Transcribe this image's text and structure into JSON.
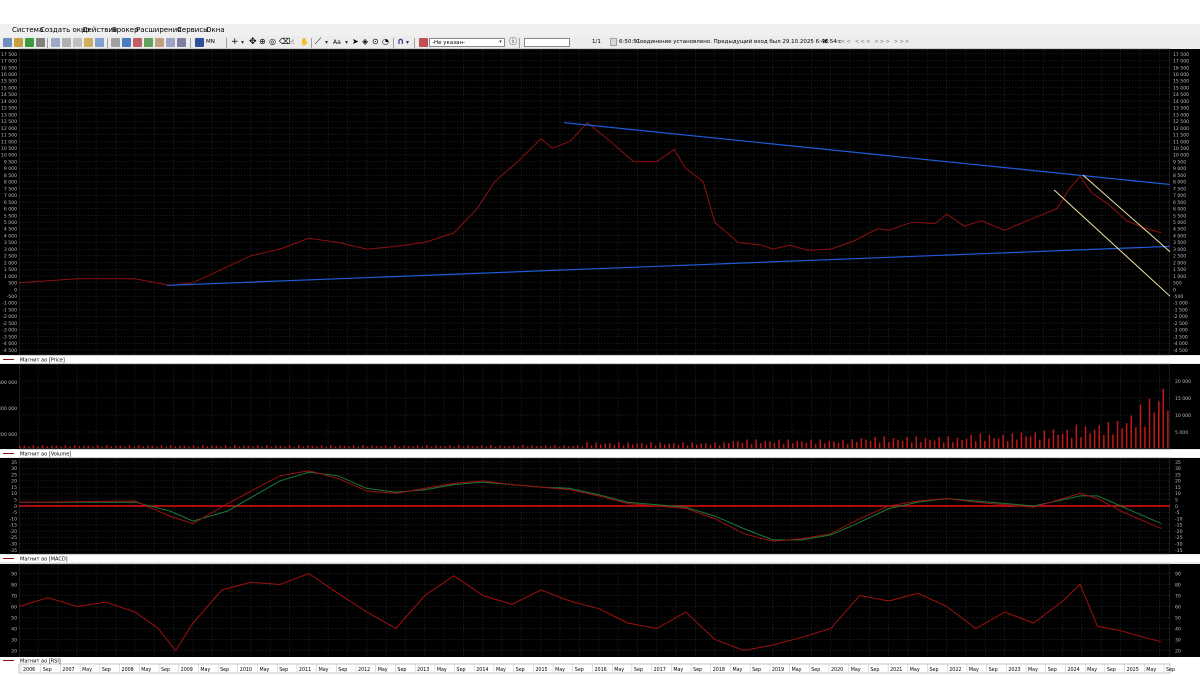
{
  "menu": [
    "Система",
    "Создать окно",
    "Действия",
    "Брокер",
    "Расширения",
    "Сервисы",
    "Окна"
  ],
  "toolbar": {
    "timeframe": "MN",
    "security_combo": "-Не указан-",
    "page_counter": "1/1",
    "status_time": "6:50:51",
    "status_message": "Соединение установлено. Предыдущий вход был 29.10.2025 6:48:54 с",
    "close_symbol": "✕",
    "nav_arrows": "<<< <<< >>> >>>"
  },
  "colors": {
    "background": "#000000",
    "grid": "#3c3c3c",
    "price_line": "#8b1010",
    "trendline_blue": "#1f5bd6",
    "channel_yellow": "#f2e6a0",
    "volume_bar": "#c01818",
    "macd_line": "#9a1010",
    "macd_signal": "#1a7a3a",
    "zero_line": "#e01010",
    "rsi_line": "#a01010"
  },
  "panels": {
    "price": {
      "legend": "Магнит ао [Price]",
      "ticks": [
        "17 500",
        "17 000",
        "16 500",
        "16 000",
        "15 500",
        "15 000",
        "14 500",
        "14 000",
        "13 500",
        "13 000",
        "12 500",
        "12 000",
        "11 500",
        "11 000",
        "10 500",
        "10 000",
        "9 500",
        "9 000",
        "8 500",
        "8 000",
        "7 500",
        "7 000",
        "6 500",
        "6 000",
        "5 500",
        "5 000",
        "4 500",
        "4 000",
        "3 500",
        "3 000",
        "2 500",
        "2 000",
        "1 500",
        "1 000",
        "500",
        "0",
        "-500",
        "-1 000",
        "-1 500",
        "-2 000",
        "-2 500",
        "-3 000",
        "-3 500",
        "-4 000",
        "-4 500"
      ]
    },
    "volume": {
      "legend": "Магнит ао [Volume]",
      "left_ticks": [
        "600 000",
        "400 000",
        "200 000"
      ],
      "right_ticks": [
        "20 000",
        "15 000",
        "10 000",
        "5 000"
      ]
    },
    "macd": {
      "legend": "Магнит ао [MACD]",
      "ticks": [
        "35",
        "30",
        "25",
        "20",
        "15",
        "10",
        "5",
        "0",
        "-5",
        "-10",
        "-15",
        "-20",
        "-25",
        "-30",
        "-35"
      ]
    },
    "rsi": {
      "legend": "Магнит ао [RSI]",
      "ticks": [
        "90",
        "80",
        "70",
        "60",
        "50",
        "40",
        "30",
        "20"
      ]
    }
  },
  "time_axis": [
    "2006",
    "Sep",
    "2007",
    "May",
    "Sep",
    "2008",
    "May",
    "Sep",
    "2009",
    "May",
    "Sep",
    "2010",
    "May",
    "Sep",
    "2011",
    "May",
    "Sep",
    "2012",
    "May",
    "Sep",
    "2013",
    "May",
    "Sep",
    "2014",
    "May",
    "Sep",
    "2015",
    "May",
    "Sep",
    "2016",
    "May",
    "Sep",
    "2017",
    "May",
    "Sep",
    "2018",
    "May",
    "Sep",
    "2019",
    "May",
    "Sep",
    "2020",
    "May",
    "Sep",
    "2021",
    "May",
    "Sep",
    "2022",
    "May",
    "Sep",
    "2023",
    "May",
    "Sep",
    "2024",
    "May",
    "Sep",
    "2025",
    "May",
    "Sep"
  ],
  "chart_data": [
    {
      "type": "line",
      "series": [
        {
          "name": "Price",
          "x": [
            2006.0,
            2007.0,
            2008.0,
            2008.6,
            2009.0,
            2009.5,
            2010.0,
            2010.5,
            2011.0,
            2011.5,
            2012.0,
            2012.5,
            2013.0,
            2013.5,
            2013.9,
            2014.2,
            2014.6,
            2015.0,
            2015.2,
            2015.5,
            2015.8,
            2016.2,
            2016.6,
            2017.0,
            2017.3,
            2017.5,
            2017.8,
            2018.0,
            2018.4,
            2018.8,
            2019.0,
            2019.3,
            2019.6,
            2020.0,
            2020.4,
            2020.8,
            2021.0,
            2021.4,
            2021.8,
            2022.0,
            2022.3,
            2022.6,
            2023.0,
            2023.5,
            2023.9,
            2024.1,
            2024.3,
            2024.5,
            2024.8,
            2025.1,
            2025.4,
            2025.7
          ],
          "values": [
            500,
            800,
            800,
            300,
            500,
            1500,
            2500,
            3000,
            3800,
            3500,
            3000,
            3200,
            3500,
            4200,
            6000,
            8000,
            9500,
            11200,
            10500,
            11000,
            12400,
            11000,
            9500,
            9500,
            10400,
            9000,
            8000,
            5000,
            3500,
            3300,
            3000,
            3300,
            2900,
            3000,
            3600,
            4500,
            4400,
            5000,
            4900,
            5600,
            4700,
            5100,
            4400,
            5300,
            6000,
            7400,
            8400,
            7200,
            6300,
            5100,
            4600,
            4200
          ]
        }
      ],
      "ylim": [
        -4500,
        17500
      ]
    },
    {
      "type": "bar",
      "series": [
        {
          "name": "Volume",
          "x_range": [
            2006.0,
            2025.8
          ],
          "values": [
            1,
            1,
            1,
            1,
            1,
            1,
            1,
            1,
            1,
            1,
            1,
            1,
            1,
            1,
            1,
            1,
            1,
            1,
            1,
            1,
            1,
            1,
            1,
            1,
            1,
            1,
            1,
            1,
            1,
            1,
            1,
            1,
            1,
            1,
            1,
            1,
            1,
            1,
            1,
            1,
            1,
            1,
            1,
            1,
            1,
            1,
            1,
            1,
            1,
            1,
            1,
            1,
            1,
            1,
            1,
            1,
            1,
            1,
            1,
            1,
            1,
            1,
            1,
            1,
            1,
            1,
            1,
            1,
            1,
            1,
            1,
            1,
            1,
            1,
            1,
            1,
            1,
            1,
            1,
            1,
            1,
            1,
            1,
            1,
            1,
            1,
            1,
            1,
            1,
            1,
            1,
            1,
            1,
            1,
            1,
            1,
            1,
            1,
            1,
            1,
            1,
            1,
            1,
            1,
            1,
            1,
            1,
            1,
            1,
            1,
            1,
            1,
            1,
            1,
            1,
            1,
            1,
            1,
            1,
            1,
            1,
            1,
            1,
            1,
            2,
            2,
            2,
            2,
            2,
            2,
            2,
            2,
            2,
            2,
            2,
            2,
            2,
            2,
            2,
            2,
            2,
            2,
            2,
            2,
            2,
            2,
            2,
            2,
            2,
            2,
            2,
            2,
            2,
            2,
            2,
            3,
            3,
            3,
            3,
            3,
            3,
            3,
            3,
            3,
            3,
            3,
            3,
            3,
            3,
            3,
            3,
            3,
            3,
            3,
            3,
            3,
            3,
            3,
            3,
            3,
            3,
            3,
            3,
            4,
            4,
            4,
            4,
            4,
            4,
            4,
            4,
            4,
            4,
            4,
            4,
            4,
            4,
            4,
            4,
            4,
            4,
            4,
            4,
            4,
            4,
            4,
            4,
            5,
            5,
            5,
            5,
            5,
            5,
            5,
            5,
            5,
            5,
            5,
            6,
            6,
            6,
            6,
            6,
            6,
            6,
            7,
            7,
            7,
            7,
            7,
            7,
            8,
            8,
            8,
            8,
            9,
            9,
            9,
            9,
            10,
            10,
            11,
            12,
            13,
            14,
            15,
            16,
            18,
            20,
            22,
            24,
            25
          ]
        }
      ]
    },
    {
      "type": "line",
      "series": [
        {
          "name": "MACD",
          "x": [
            2006.0,
            2008.0,
            2008.6,
            2009.0,
            2009.6,
            2010.5,
            2011.0,
            2011.5,
            2012.0,
            2012.5,
            2013.0,
            2013.5,
            2014.0,
            2014.5,
            2015.0,
            2015.5,
            2016.0,
            2016.5,
            2017.0,
            2017.5,
            2018.0,
            2018.5,
            2019.0,
            2019.5,
            2020.0,
            2020.5,
            2021.0,
            2021.5,
            2022.0,
            2022.5,
            2023.0,
            2023.5,
            2024.0,
            2024.3,
            2024.6,
            2025.0,
            2025.4,
            2025.7
          ],
          "values": [
            3,
            4,
            -8,
            -14,
            2,
            24,
            28,
            22,
            12,
            10,
            14,
            18,
            20,
            17,
            15,
            13,
            8,
            2,
            0,
            -2,
            -10,
            -22,
            -28,
            -26,
            -22,
            -10,
            0,
            4,
            6,
            3,
            1,
            -1,
            6,
            10,
            6,
            -4,
            -12,
            -18
          ]
        },
        {
          "name": "Signal",
          "x": [
            2006.0,
            2008.0,
            2008.6,
            2009.0,
            2009.6,
            2010.5,
            2011.0,
            2011.5,
            2012.0,
            2012.5,
            2013.0,
            2013.5,
            2014.0,
            2014.5,
            2015.0,
            2015.5,
            2016.0,
            2016.5,
            2017.0,
            2017.5,
            2018.0,
            2018.5,
            2019.0,
            2019.5,
            2020.0,
            2020.5,
            2021.0,
            2021.5,
            2022.0,
            2022.5,
            2023.0,
            2023.5,
            2024.0,
            2024.3,
            2024.6,
            2025.0,
            2025.4,
            2025.7
          ],
          "values": [
            3,
            3,
            -4,
            -12,
            -4,
            20,
            27,
            24,
            14,
            11,
            13,
            17,
            19,
            17,
            15,
            14,
            9,
            3,
            1,
            -1,
            -8,
            -18,
            -27,
            -27,
            -23,
            -13,
            -2,
            3,
            6,
            4,
            2,
            0,
            5,
            8,
            8,
            0,
            -8,
            -14
          ]
        }
      ],
      "ylim": [
        -35,
        35
      ]
    },
    {
      "type": "line",
      "series": [
        {
          "name": "RSI",
          "x": [
            2006.0,
            2006.5,
            2007.0,
            2007.5,
            2008.0,
            2008.4,
            2008.7,
            2009.0,
            2009.5,
            2010.0,
            2010.5,
            2011.0,
            2011.5,
            2012.0,
            2012.5,
            2013.0,
            2013.5,
            2014.0,
            2014.5,
            2015.0,
            2015.5,
            2016.0,
            2016.5,
            2017.0,
            2017.5,
            2018.0,
            2018.5,
            2019.0,
            2019.5,
            2020.0,
            2020.5,
            2021.0,
            2021.5,
            2022.0,
            2022.5,
            2023.0,
            2023.5,
            2024.0,
            2024.3,
            2024.6,
            2025.0,
            2025.4,
            2025.7
          ],
          "values": [
            60,
            68,
            60,
            64,
            55,
            40,
            20,
            45,
            75,
            82,
            80,
            90,
            72,
            55,
            40,
            70,
            88,
            70,
            62,
            75,
            65,
            58,
            45,
            40,
            55,
            30,
            20,
            25,
            32,
            40,
            70,
            65,
            72,
            60,
            40,
            55,
            45,
            65,
            80,
            42,
            38,
            32,
            28
          ]
        }
      ],
      "ylim": [
        15,
        95
      ]
    }
  ]
}
